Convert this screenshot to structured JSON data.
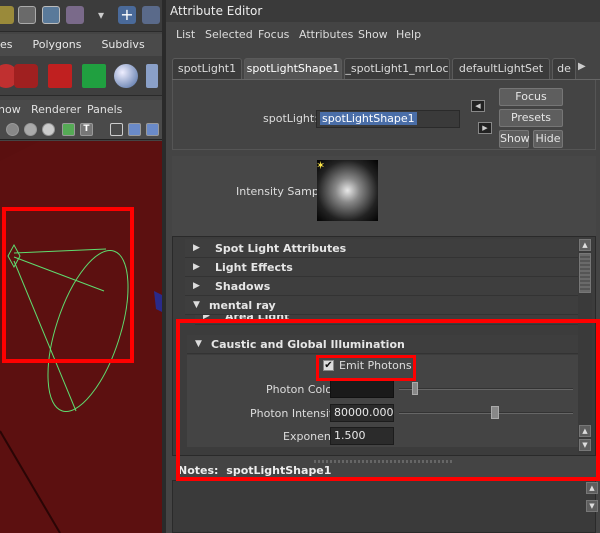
{
  "left_panel": {
    "menu_sets": [
      "es",
      "Polygons",
      "Subdivs"
    ],
    "viewport_menu": [
      "how",
      "Renderer",
      "Panels"
    ],
    "viewport_tool_text": "T"
  },
  "attribute_editor": {
    "title": "Attribute Editor",
    "menu": [
      "List",
      "Selected",
      "Focus",
      "Attributes",
      "Show",
      "Help"
    ],
    "tabs": [
      "spotLight1",
      "spotLightShape1",
      "_spotLight1_mrLoc",
      "defaultLightSet",
      "de"
    ],
    "active_tab": "spotLightShape1",
    "node_label": "spotLight:",
    "node_value": "spotLightShape1",
    "buttons": {
      "focus": "Focus",
      "presets": "Presets",
      "show": "Show",
      "hide": "Hide"
    },
    "intensity_sample_label": "Intensity Sample",
    "sections": [
      {
        "label": "Spot Light Attributes",
        "expanded": false
      },
      {
        "label": "Light Effects",
        "expanded": false
      },
      {
        "label": "Shadows",
        "expanded": false
      },
      {
        "label": "mental ray",
        "expanded": true
      },
      {
        "label": "Area Light",
        "expanded": false
      },
      {
        "label": "Caustic and Global Illumination",
        "expanded": true
      }
    ],
    "emit_photons_label": "Emit Photons",
    "emit_photons_checked": true,
    "photon_color_label": "Photon Color",
    "photon_intensity_label": "Photon Intensity",
    "photon_intensity_value": "80000.000",
    "photon_intensity_slider_fraction": 0.55,
    "exponent_label": "Exponent",
    "exponent_value": "1.500",
    "notes_label": "Notes:",
    "notes_value": "spotLightShape1"
  },
  "colors": {
    "highlight": "#ff0000",
    "viewport": "#5a0f0f",
    "light_wire": "#5fdc6f"
  }
}
